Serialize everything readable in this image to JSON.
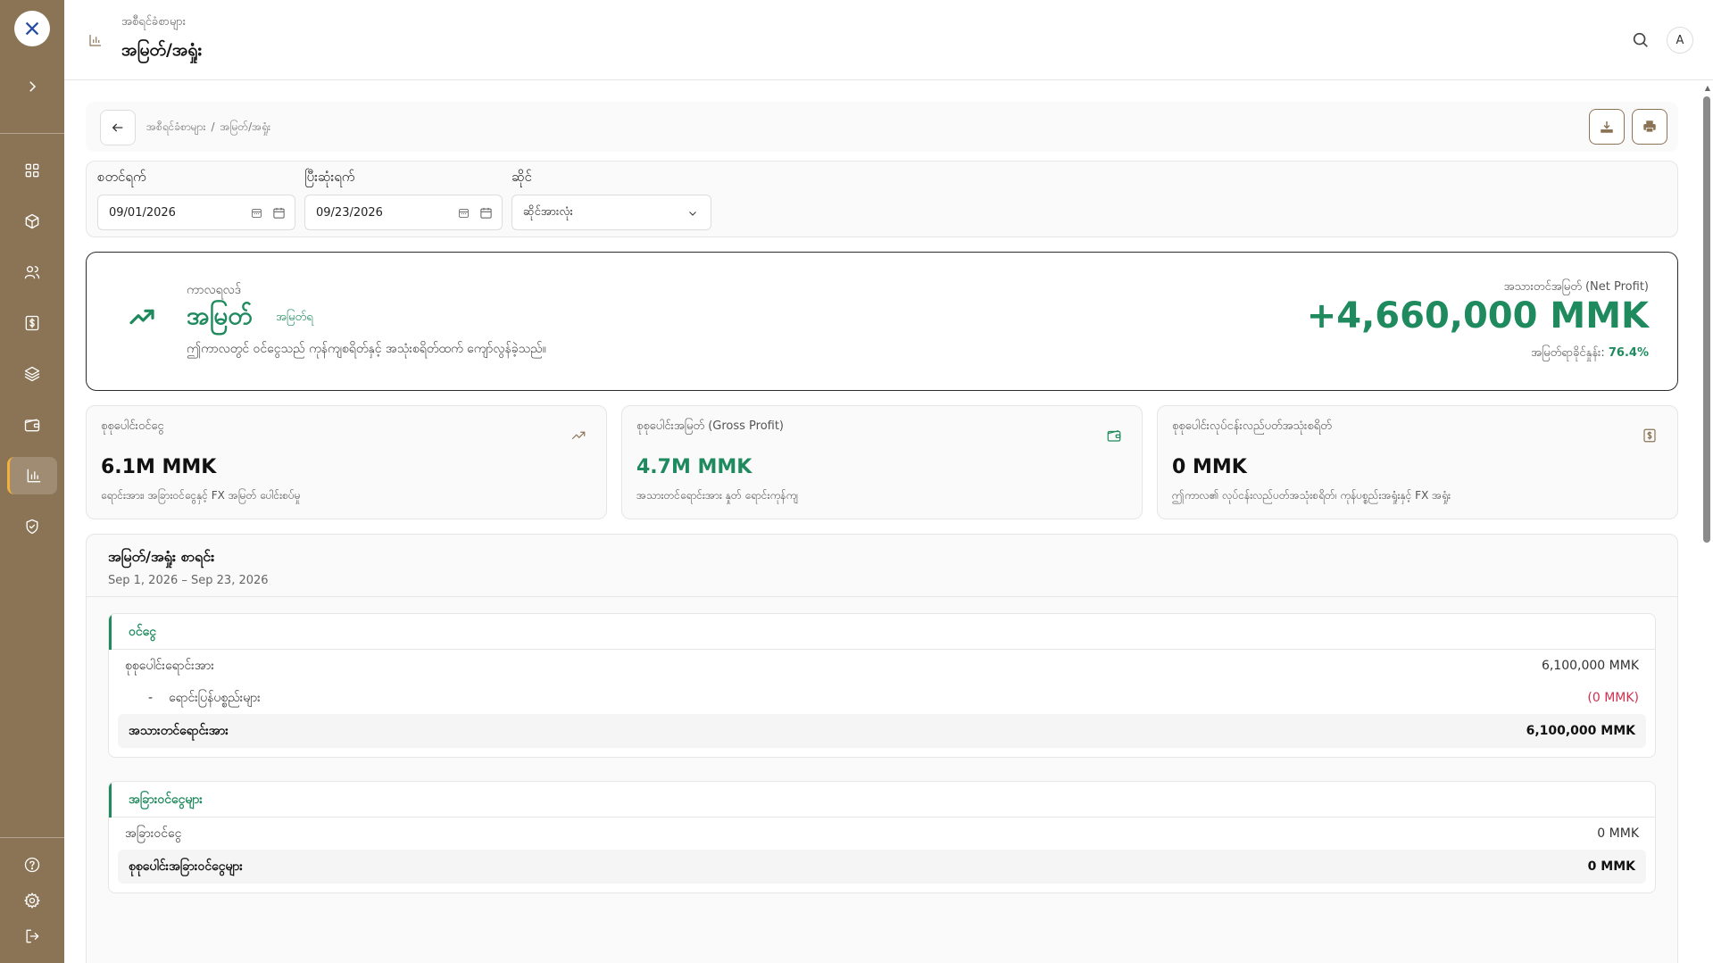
{
  "header": {
    "breadcrumb_parent": "အစီရင်ခံစာများ",
    "title": "အမြတ်/အရှုံး"
  },
  "user": {
    "avatar_initial": "A"
  },
  "breadcrumb": {
    "parent": "အစီရင်ခံစာများ",
    "separator": "/",
    "current": "အမြတ်/အရှုံး"
  },
  "filters": {
    "start_label": "စတင်ရက်",
    "start_value": "09/01/2026",
    "end_label": "ပြီးဆုံးရက်",
    "end_value": "09/23/2026",
    "shop_label": "ဆိုင်",
    "shop_value": "ဆိုင်အားလုံး"
  },
  "summary": {
    "period_label": "ကာလရလဒ်",
    "status": "အမြတ်",
    "status_badge": "အမြတ်ရ",
    "description": "ဤကာလတွင် ဝင်ငွေသည် ကုန်ကျစရိတ်နှင့် အသုံးစရိတ်ထက် ကျော်လွန်ခဲ့သည်။",
    "net_profit_label": "အသားတင်အမြတ် (Net Profit)",
    "net_profit_value": "+4,660,000 MMK",
    "margin_label": "အမြတ်ရာခိုင်နှုန်း:",
    "margin_value": "76.4%",
    "accent_color": "#1e8a5e"
  },
  "cards": [
    {
      "label": "စုစုပေါင်းဝင်ငွေ",
      "value": "6.1M MMK",
      "desc": "ရောင်းအား၊ အခြားဝင်ငွေနှင့် FX အမြတ် ပေါင်းစပ်မှု",
      "icon": "trend-up-icon"
    },
    {
      "label": "စုစုပေါင်းအမြတ် (Gross Profit)",
      "value": "4.7M MMK",
      "desc": "အသားတင်ရောင်းအား နှုတ် ရောင်းကုန်ကျ",
      "icon": "wallet-icon"
    },
    {
      "label": "စုစုပေါင်းလုပ်ငန်းလည်ပတ်အသုံးစရိတ်",
      "value": "0 MMK",
      "desc": "ဤကာလ၏ လုပ်ငန်းလည်ပတ်အသုံးစရိတ်၊ ကုန်ပစ္စည်းအရှုံးနှင့် FX အရှုံး",
      "icon": "dollar-doc-icon"
    }
  ],
  "statement": {
    "title": "အမြတ်/အရှုံး စာရင်း",
    "range": "Sep 1, 2026 – Sep 23, 2026",
    "sections": [
      {
        "title": "ဝင်ငွေ",
        "rows": [
          {
            "label": "စုစုပေါင်းရောင်းအား",
            "value": "6,100,000 MMK"
          },
          {
            "bullet": "-",
            "label": "ရောင်းပြန်ပစ္စည်းများ",
            "value": "(0 MMK)"
          }
        ],
        "total_label": "အသားတင်ရောင်းအား",
        "total_value": "6,100,000 MMK"
      },
      {
        "title": "အခြားဝင်ငွေများ",
        "rows": [
          {
            "label": "အခြားဝင်ငွေ",
            "value": "0 MMK"
          }
        ],
        "total_label": "စုစုပေါင်းအခြားဝင်ငွေများ",
        "total_value": "0 MMK"
      }
    ]
  }
}
